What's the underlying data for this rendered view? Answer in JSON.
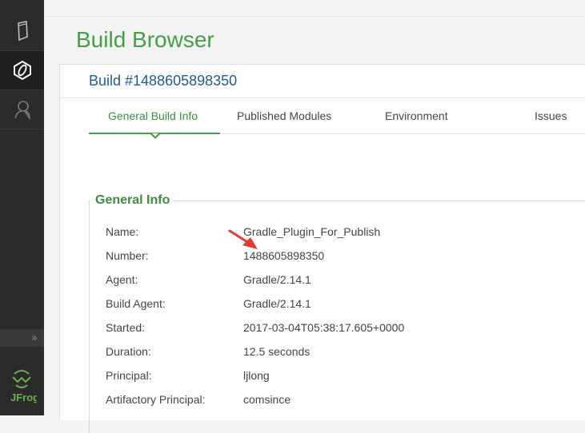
{
  "page_title": "Build Browser",
  "build": {
    "header": "Build #1488605898350"
  },
  "tabs": [
    {
      "label": "General Build Info"
    },
    {
      "label": "Published Modules"
    },
    {
      "label": "Environment"
    },
    {
      "label": "Issues"
    }
  ],
  "general_info": {
    "title": "General Info",
    "rows": [
      {
        "label": "Name:",
        "value": "Gradle_Plugin_For_Publish"
      },
      {
        "label": "Number:",
        "value": "1488605898350"
      },
      {
        "label": "Agent:",
        "value": "Gradle/2.14.1"
      },
      {
        "label": "Build Agent:",
        "value": "Gradle/2.14.1"
      },
      {
        "label": "Started:",
        "value": "2017-03-04T05:38:17.605+0000"
      },
      {
        "label": "Duration:",
        "value": "12.5 seconds"
      },
      {
        "label": "Principal:",
        "value": "ljlong"
      },
      {
        "label": "Artifactory Principal:",
        "value": "comsince"
      }
    ]
  },
  "sidebar": {
    "items": [
      {
        "icon": "artifacts-icon"
      },
      {
        "icon": "builds-icon"
      },
      {
        "icon": "admin-user-icon"
      }
    ],
    "collapse_label": "»",
    "logo_text": "JFrog"
  },
  "colors": {
    "accent_green": "#43a047",
    "link_blue": "#1f5c96",
    "annotation_red": "#e53935",
    "sidebar_bg": "#2b2b2b"
  }
}
